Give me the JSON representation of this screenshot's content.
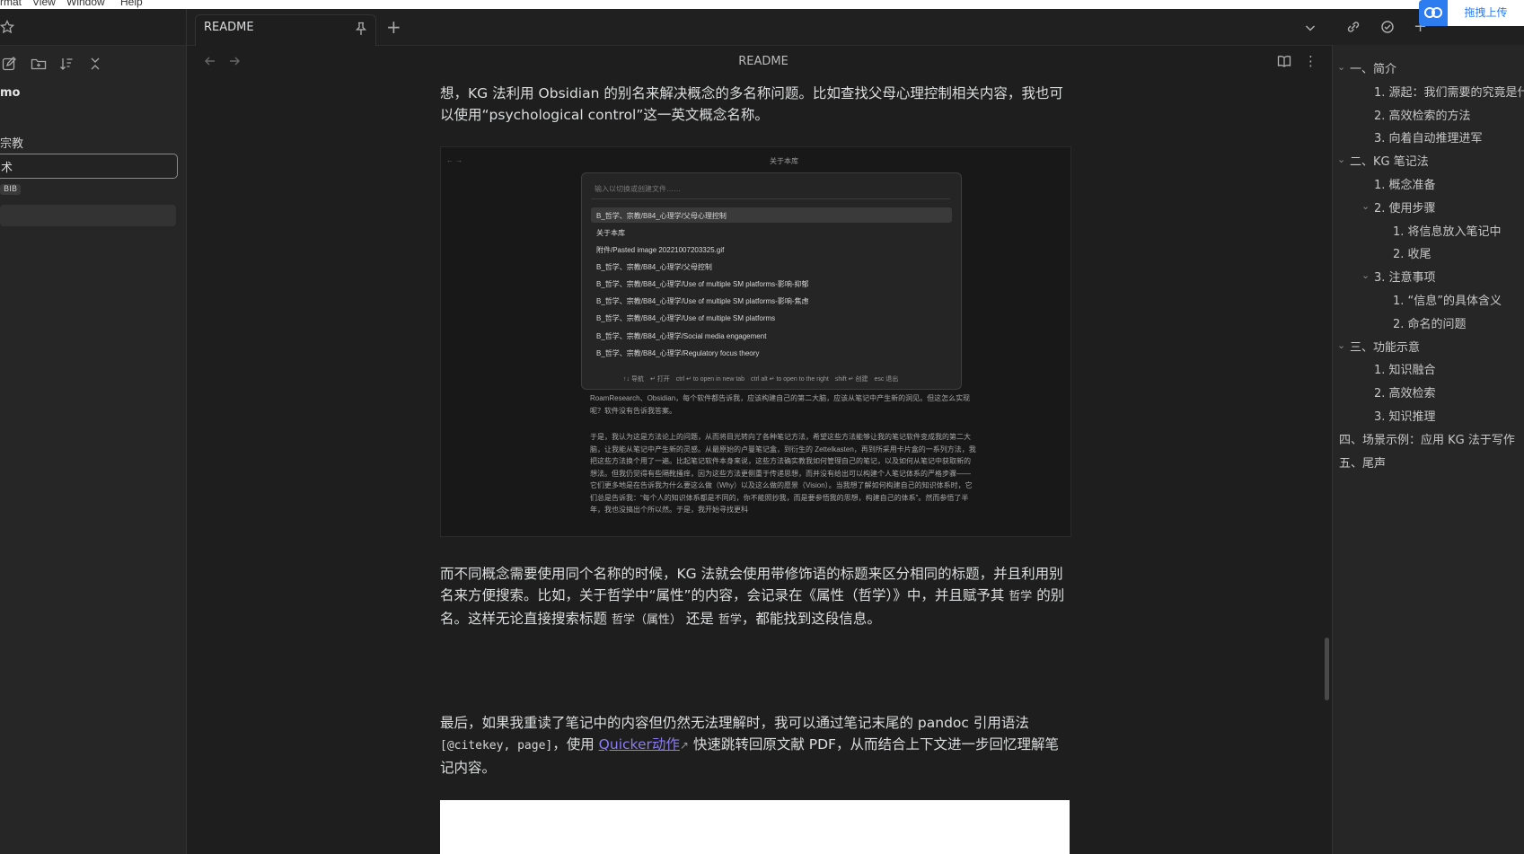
{
  "menubar": {
    "items": [
      "rmat",
      "View",
      "Window",
      "Help"
    ]
  },
  "tabs": [
    {
      "label": "README"
    }
  ],
  "view_header": {
    "title": "README"
  },
  "left_sidebar": {
    "vault_name": "mo",
    "folder_label": "宗教",
    "selected_label": "术",
    "badge": "BIB"
  },
  "content": {
    "para1": "想，KG 法利用 Obsidian 的别名来解决概念的多名称问题。比如查找父母心理控制相关内容，我也可以使用“psychological control”这一英文概念名称。",
    "para2_a": "而不同概念需要使用同个名称的时候，KG 法就会使用带修饰语的标题来区分相同的标题，并且利用别名来方便搜索。比如，关于哲学中“属性”的内容，会记录在《属性（哲学）》中，并且赋予其 ",
    "para2_code1": "哲学",
    "para2_b": " 的别名。这样无论直接搜索标题 ",
    "para2_code2": "哲学（属性）",
    "para2_c": " 还是 ",
    "para2_code3": "哲学",
    "para2_d": "，都能找到这段信息。",
    "para3_a": "最后，如果我重读了笔记中的内容但仍然无法理解时，我可以通过笔记末尾的 pandoc 引用语法 ",
    "para3_code": "[@citekey, page]",
    "para3_b": "，使用 ",
    "para3_link": "Quicker动作",
    "para3_c": " 快速跳转回原文献 PDF，从而结合上下文进一步回忆理解笔记内容。"
  },
  "embedded_image": {
    "title": "关于本库",
    "search_placeholder": "输入以切换或创建文件……",
    "rows": [
      "B_哲学、宗教/B84_心理学/父母心理控制",
      "关于本库",
      "附件/Pasted image 20221007203325.gif",
      "B_哲学、宗教/B84_心理学/父母控制",
      "B_哲学、宗教/B84_心理学/Use of multiple SM platforms-影响-抑郁",
      "B_哲学、宗教/B84_心理学/Use of multiple SM platforms-影响-焦虑",
      "B_哲学、宗教/B84_心理学/Use of multiple SM platforms",
      "B_哲学、宗教/B84_心理学/Social media engagement",
      "B_哲学、宗教/B84_心理学/Regulatory focus theory"
    ],
    "footer": "↑↓ 导航　↵ 打开　ctrl ↵ to open in new tab　ctrl alt ↵ to open to the right　shift ↵ 创建　esc 退出",
    "below_text_1": "RoamResearch、Obsidian，每个软件都告诉我，应该构建自己的第二大脑，应该从笔记中产生新的洞见。但这怎么实现呢？软件没有告诉我答案。",
    "below_text_2": "于是，我认为这是方法论上的问题，从而将目光转向了各种笔记方法，希望这些方法能够让我的笔记软件变成我的第二大脑，让我能从笔记中产生新的灵感。从最原始的卢曼笔记盒，到衍生的 Zettelkasten，再到所采用卡片盒的一系列方法，我把这些方法换个用了一遍。比起笔记软件本身来说，这些方法确实教我如何管理自己的笔记，以及如何从笔记中获取新的想法。但我仍觉得有些隔靴搔痒，因为这些方法更侧重于传递思想，而并没有给出可以构建个人笔记体系的严格步骤——它们更多地是在告诉我为什么要这么做（Why）以及这么做的愿景（Vision）。当我想了解如何构建自己的知识体系时，它们总是告诉我：“每个人的知识体系都是不同的，你不能照抄我，而是要参悟我的思想，构建自己的体系”。然而参悟了半年，我也没搞出个所以然。于是，我开始寻找更科"
  },
  "outline": [
    {
      "label": "一、简介",
      "level": 0,
      "collapsible": true
    },
    {
      "label": "1. 源起：我们需要的究竟是什",
      "level": 1,
      "collapsible": false
    },
    {
      "label": "2. 高效检索的方法",
      "level": 1,
      "collapsible": false
    },
    {
      "label": "3. 向着自动推理进军",
      "level": 1,
      "collapsible": false
    },
    {
      "label": "二、KG 笔记法",
      "level": 0,
      "collapsible": true
    },
    {
      "label": "1. 概念准备",
      "level": 1,
      "collapsible": false
    },
    {
      "label": "2. 使用步骤",
      "level": 1,
      "collapsible": true
    },
    {
      "label": "1. 将信息放入笔记中",
      "level": 2,
      "collapsible": false
    },
    {
      "label": "2. 收尾",
      "level": 2,
      "collapsible": false
    },
    {
      "label": "3. 注意事项",
      "level": 1,
      "collapsible": true
    },
    {
      "label": "1. “信息”的具体含义",
      "level": 2,
      "collapsible": false
    },
    {
      "label": "2. 命名的问题",
      "level": 2,
      "collapsible": false
    },
    {
      "label": "三、功能示意",
      "level": 0,
      "collapsible": true
    },
    {
      "label": "1. 知识融合",
      "level": 1,
      "collapsible": false
    },
    {
      "label": "2. 高效检索",
      "level": 1,
      "collapsible": false
    },
    {
      "label": "3. 知识推理",
      "level": 1,
      "collapsible": false
    },
    {
      "label": "四、场景示例：应用 KG 法于写作",
      "level": 0,
      "collapsible": false
    },
    {
      "label": "五、尾声",
      "level": 0,
      "collapsible": false
    }
  ],
  "upload": {
    "label": "拖拽上传"
  },
  "colors": {
    "background": "#1e1e1e",
    "sidebar": "#262626",
    "link": "#8a7cf0",
    "upload_blue": "#2d7cf0"
  }
}
